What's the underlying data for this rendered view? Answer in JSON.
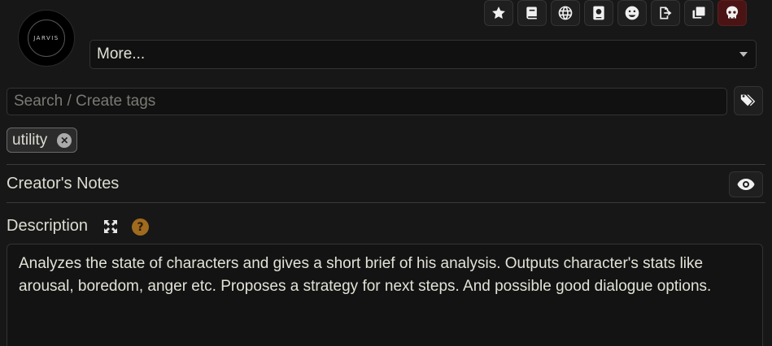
{
  "avatar": {
    "logo_text": "JARVIS"
  },
  "toolbar": {
    "icons": [
      "star-icon",
      "book-icon",
      "globe-icon",
      "passport-icon",
      "smile-icon",
      "export-icon",
      "clone-icon",
      "skull-icon"
    ]
  },
  "more_select": {
    "value": "More..."
  },
  "tags": {
    "search_placeholder": "Search / Create tags",
    "items": [
      {
        "label": "utility"
      }
    ]
  },
  "creators_notes": {
    "label": "Creator's Notes"
  },
  "description": {
    "label": "Description",
    "help_glyph": "?",
    "text": "Analyzes the state of characters and gives a short brief of his analysis. Outputs character's stats like arousal, boredom, anger etc. Proposes a strategy for next steps. And possible good dialogue options."
  },
  "colors": {
    "background": "#171717",
    "danger_button": "#4a1414",
    "help_badge": "#a06a1f"
  }
}
